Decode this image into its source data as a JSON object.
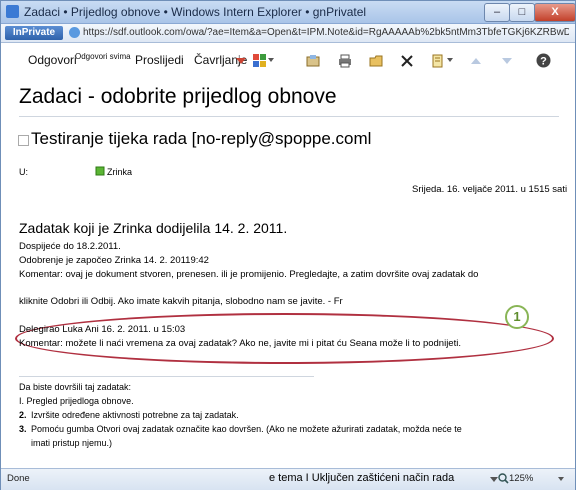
{
  "window": {
    "title": "Zadaci • Prijedlog obnove • Windows Intern Explorer • gnPrivatel",
    "minimize": "–",
    "maximize": "□",
    "close": "X"
  },
  "address": {
    "inprivate": "InPrivate",
    "url": "https://sdf.outlook.com/owa/?ae=Item&a=Open&t=IPM.Note&id=RgAAAAAb%2bk5ntMm3TbfeTGKj6KZRBwDFtt1A\\"
  },
  "toolbar": {
    "reply": "Odgovori",
    "reply_all": "Odgovori svima",
    "forward": "Proslijedi",
    "chat": "Čavrljanje"
  },
  "page_title": "Zadaci - odobrite prijedlog obnove",
  "subject": "Testiranje tijeka rada [no-reply@spoppe.coml",
  "to_label": "U:",
  "to_value": "Zrinka",
  "date": "Srijeda. 16. veljače 2011. u 1515 sati",
  "task": {
    "heading": "Zadatak koji je Zrinka dodijelila 14. 2. 2011.",
    "due": "Dospijeće do 18.2.2011.",
    "started": "Odobrenje je započeo Zrinka 14. 2. 20119:42",
    "comment1": "Komentar: ovaj je dokument stvoren, prenesen. ili je promijenio. Pregledajte, a zatim dovršite ovaj zadatak do",
    "comment2": "kliknite Odobri ili Odbij. Ako imate kakvih pitanja, slobodno nam se javite. - Fr",
    "delegated": "Delegirao Luka Ani 16. 2. 2011. u 15:03",
    "delegated_comment": "Komentar: možete li naći vremena za ovaj zadatak? Ako ne, javite mi i pitat ću Seana može li to podnijeti."
  },
  "callout_number": "1",
  "instructions": {
    "intro": "Da biste dovršili taj zadatak:",
    "step1": "I. Pregled prijedloga obnove.",
    "step2_num": "2.",
    "step2": "Izvršite određene aktivnosti potrebne za taj zadatak.",
    "step3_num": "3.",
    "step3a": "Pomoću gumba Otvori ovaj zadatak označite kao dovršen. (Ako ne možete ažurirati zadatak, možda neće te",
    "step3b": "imati pristup njemu.)"
  },
  "status": {
    "left": "Done",
    "middle": "e tema I Uključen zaštićeni način rada",
    "zoom": "125%"
  }
}
